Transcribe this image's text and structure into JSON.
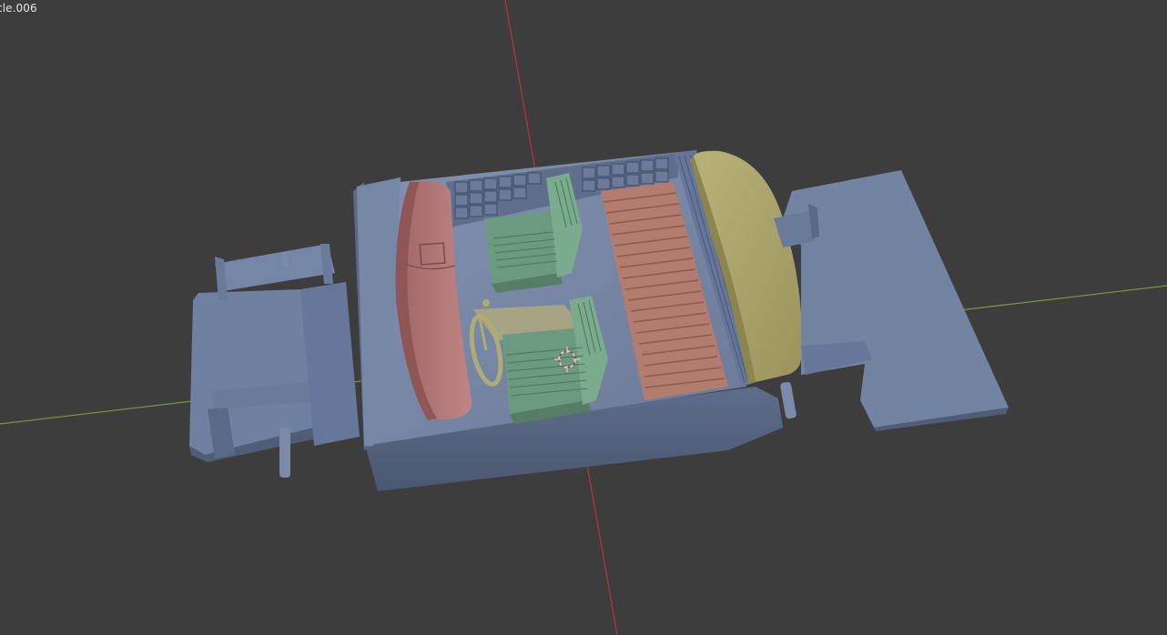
{
  "viewport": {
    "object_label": "cle.006",
    "background_color": "#3d3d3d",
    "axis_x_color": "#7a9a3a",
    "axis_y_color": "#b8343c"
  },
  "model": {
    "chassis_color": "#6f80a0",
    "chassis_dark_color": "#4f5d78",
    "seat_color": "#6b9a7e",
    "dashboard_color": "#b07575",
    "bed_color": "#b27c6e",
    "canopy_color": "#a9a26a",
    "steering_color": "#b0aa73"
  },
  "cursor": {
    "icon": "3d-cursor-icon"
  }
}
